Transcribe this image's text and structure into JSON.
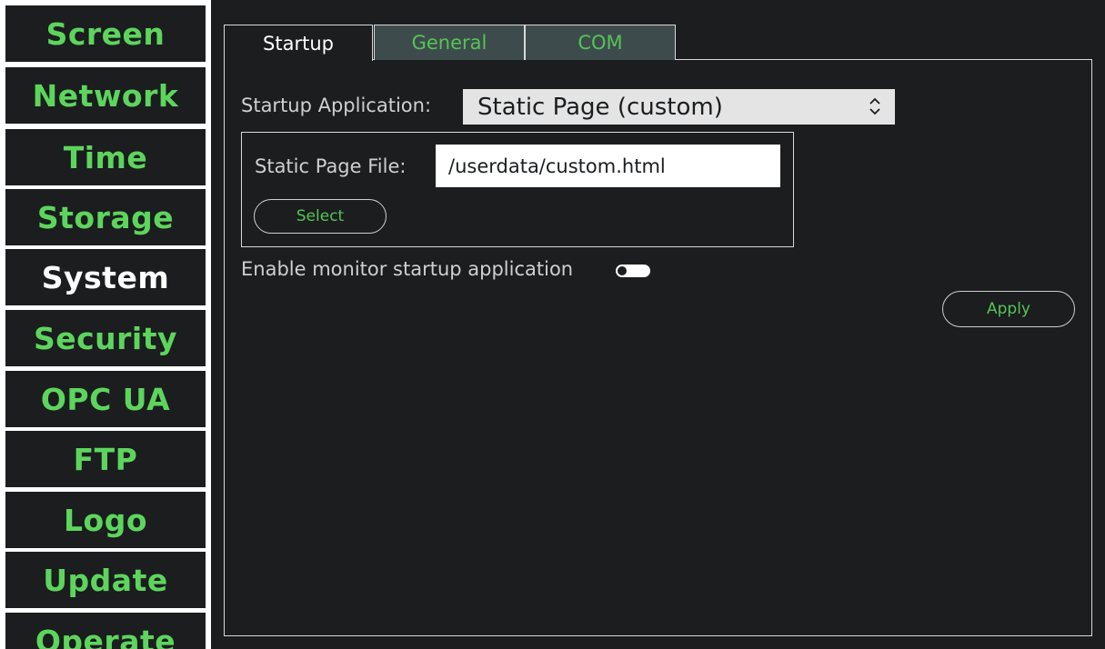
{
  "sidebar": {
    "items": [
      {
        "label": "Screen",
        "active": false
      },
      {
        "label": "Network",
        "active": false
      },
      {
        "label": "Time",
        "active": false
      },
      {
        "label": "Storage",
        "active": false
      },
      {
        "label": "System",
        "active": true
      },
      {
        "label": "Security",
        "active": false
      },
      {
        "label": "OPC UA",
        "active": false
      },
      {
        "label": "FTP",
        "active": false
      },
      {
        "label": "Logo",
        "active": false
      },
      {
        "label": "Update",
        "active": false
      },
      {
        "label": "Operate",
        "active": false
      }
    ]
  },
  "tabs": [
    {
      "label": "Startup",
      "active": true
    },
    {
      "label": "General",
      "active": false
    },
    {
      "label": "COM",
      "active": false
    }
  ],
  "startup": {
    "application_label": "Startup Application:",
    "application_value": "Static Page (custom)",
    "file_label": "Static Page File:",
    "file_value": "/userdata/custom.html",
    "select_button": "Select",
    "monitor_label": "Enable monitor startup application",
    "monitor_enabled": false,
    "apply_button": "Apply"
  },
  "icons": {
    "select_arrows": "chevron-up-down-icon"
  },
  "colors": {
    "accent_green": "#5dd55d",
    "background": "#1b1d1f",
    "inactive_tab": "#3e4b4d"
  }
}
